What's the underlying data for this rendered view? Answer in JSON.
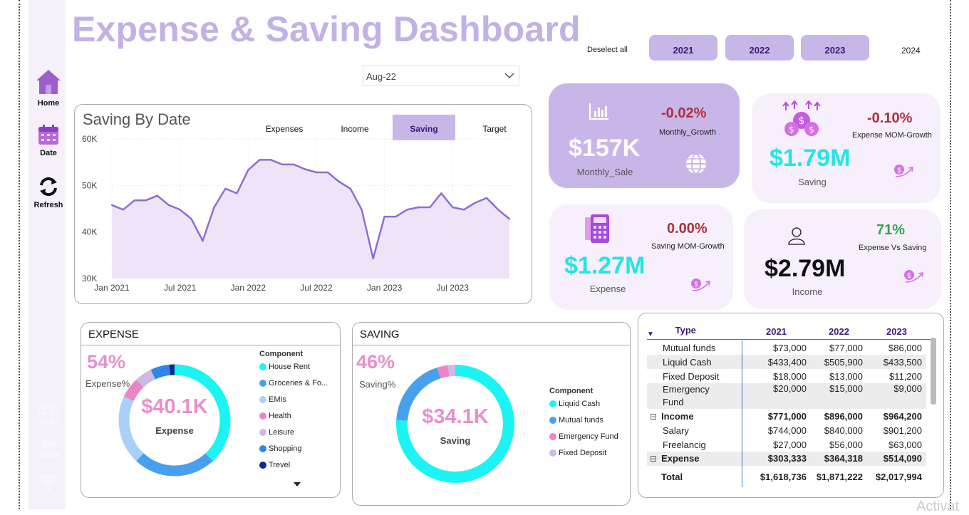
{
  "header": {
    "title": "Expense & Saving Dashboard",
    "deselect_label": "Deselect all",
    "years": [
      "2021",
      "2022",
      "2023",
      "2024"
    ],
    "month_filter": "Aug-22"
  },
  "sidebar": {
    "items": [
      {
        "label": "Home",
        "icon": "home-icon"
      },
      {
        "label": "Date",
        "icon": "calendar-icon"
      },
      {
        "label": "Refresh",
        "icon": "refresh-icon"
      }
    ],
    "faded_icons": [
      "globe-icon",
      "users-icon",
      "filter-icon"
    ]
  },
  "saving_chart": {
    "tabs": [
      "Expenses",
      "Income",
      "Saving",
      "Target"
    ],
    "active_tab": "Saving"
  },
  "chart_data": {
    "type": "area",
    "title": "Saving By Date",
    "x_tick_labels": [
      "Jan 2021",
      "Jul 2021",
      "Jan 2022",
      "Jul 2022",
      "Jan 2023",
      "Jul 2023"
    ],
    "y_tick_labels": [
      "60K",
      "50K",
      "40K",
      "30K"
    ],
    "ylim": [
      30000,
      60000
    ],
    "x": [
      "2021-01",
      "2021-02",
      "2021-03",
      "2021-04",
      "2021-05",
      "2021-06",
      "2021-07",
      "2021-08",
      "2021-09",
      "2021-10",
      "2021-11",
      "2021-12",
      "2022-01",
      "2022-02",
      "2022-03",
      "2022-04",
      "2022-05",
      "2022-06",
      "2022-07",
      "2022-08",
      "2022-09",
      "2022-10",
      "2022-11",
      "2022-12",
      "2023-01",
      "2023-02",
      "2023-03",
      "2023-04",
      "2023-05",
      "2023-06",
      "2023-07",
      "2023-08",
      "2023-09",
      "2023-10",
      "2023-11",
      "2023-12"
    ],
    "values": [
      45800,
      44800,
      46800,
      46800,
      47800,
      45800,
      44800,
      42800,
      38100,
      45300,
      49300,
      48300,
      53300,
      55500,
      55500,
      54500,
      54500,
      53500,
      52800,
      52800,
      50800,
      49300,
      44800,
      34300,
      43300,
      43300,
      44800,
      45300,
      45300,
      48300,
      45300,
      44800,
      46300,
      47300,
      44800,
      42800
    ],
    "series_color": "#8f6ccf",
    "fill_color": "#ede5f7",
    "grid": true
  },
  "kpis": {
    "monthly_sale": {
      "value": "$157K",
      "label": "Monthly_Sale",
      "pct": "-0.02%",
      "pct_label": "Monthly_Growth"
    },
    "saving": {
      "value": "$1.79M",
      "label": "Saving",
      "pct": "-0.10%",
      "pct_label": "Expense MOM-Growth"
    },
    "expense": {
      "value": "$1.27M",
      "label": "Expense",
      "pct": "0.00%",
      "pct_label": "Saving MOM-Growth"
    },
    "income": {
      "value": "$2.79M",
      "label": "Income",
      "pct": "71%",
      "pct_label": "Expense Vs Saving"
    }
  },
  "expense_donut": {
    "title": "EXPENSE",
    "pct": "54%",
    "pct_label": "Expense%",
    "center_value": "$40.1K",
    "center_label": "Expense",
    "legend_title": "Component",
    "components": [
      {
        "name": "House Rent",
        "color": "#1cf3f3"
      },
      {
        "name": "Groceries & Fo...",
        "color": "#47a0ee"
      },
      {
        "name": "EMIs",
        "color": "#a9d0f8"
      },
      {
        "name": "Health",
        "color": "#ea85c7"
      },
      {
        "name": "Leisure",
        "color": "#cdb9e8"
      },
      {
        "name": "Shopping",
        "color": "#2f86e6"
      },
      {
        "name": "Trevel",
        "color": "#102a8a"
      }
    ]
  },
  "saving_donut": {
    "title": "SAVING",
    "pct": "46%",
    "pct_label": "Saving%",
    "center_value": "$34.1K",
    "center_label": "Saving",
    "legend_title": "Component",
    "components": [
      {
        "name": "Liquid Cash",
        "color": "#1cf3f3"
      },
      {
        "name": "Mutual funds",
        "color": "#47a0ee"
      },
      {
        "name": "Emergency Fund",
        "color": "#ea85c7"
      },
      {
        "name": "Fixed Deposit",
        "color": "#cdb9e8"
      }
    ]
  },
  "matrix": {
    "headers": [
      "Type",
      "2021",
      "2022",
      "2023"
    ],
    "rows": [
      {
        "name": "Mutual funds",
        "v": [
          "$73,000",
          "$77,000",
          "$86,000"
        ]
      },
      {
        "name": "Liquid Cash",
        "v": [
          "$433,400",
          "$505,900",
          "$433,500"
        ]
      },
      {
        "name": "Fixed Deposit",
        "v": [
          "$18,000",
          "$13,000",
          "$11,200"
        ]
      },
      {
        "name": "Emergency Fund",
        "v": [
          "$20,000",
          "$15,000",
          "$9,000"
        ]
      },
      {
        "name": "Income",
        "v": [
          "$771,000",
          "$896,000",
          "$964,200"
        ]
      },
      {
        "name": "Salary",
        "v": [
          "$744,000",
          "$840,000",
          "$901,200"
        ]
      },
      {
        "name": "Freelancig",
        "v": [
          "$27,000",
          "$56,000",
          "$63,000"
        ]
      },
      {
        "name": "Expense",
        "v": [
          "$303,333",
          "$364,318",
          "$514,090"
        ]
      },
      {
        "name": "Total",
        "v": [
          "$1,618,736",
          "$1,871,222",
          "$2,017,994"
        ]
      }
    ],
    "collapse_glyph": "⊟"
  },
  "watermark": "Activat"
}
